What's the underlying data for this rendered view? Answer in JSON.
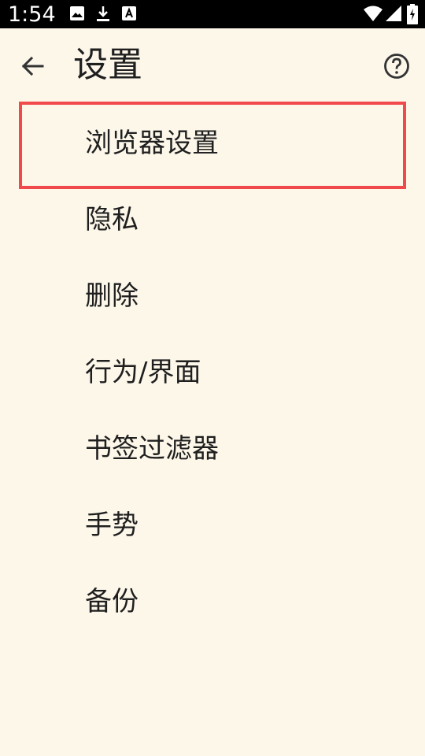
{
  "status_bar": {
    "time": "1:54",
    "icons": [
      "image-icon",
      "download-icon",
      "font-icon",
      "wifi-icon",
      "signal-icon",
      "battery-icon"
    ]
  },
  "app_bar": {
    "title": "设置",
    "back_icon": "back-arrow-icon",
    "help_icon": "help-icon"
  },
  "settings": {
    "items": [
      {
        "label": "浏览器设置"
      },
      {
        "label": "隐私"
      },
      {
        "label": "删除"
      },
      {
        "label": "行为/界面"
      },
      {
        "label": "书签过滤器"
      },
      {
        "label": "手势"
      },
      {
        "label": "备份"
      }
    ]
  },
  "colors": {
    "background": "#fdf7ea",
    "text": "#1f1f1f",
    "highlight": "#f14a4c",
    "status_bar": "#000000"
  }
}
